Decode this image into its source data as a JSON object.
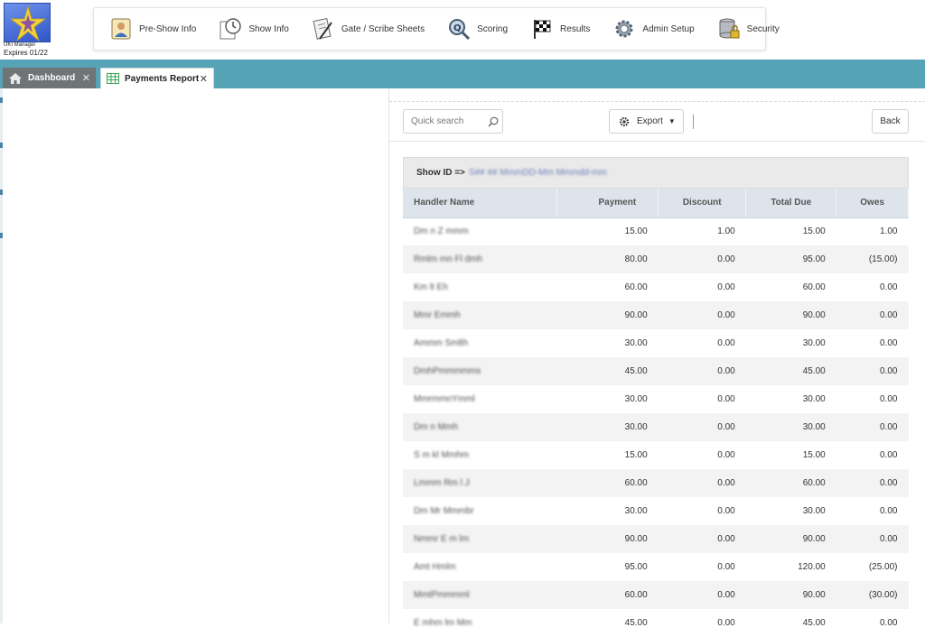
{
  "app": {
    "logo_caption": "UKI Manager",
    "logo_expiry": "Expires 01/22"
  },
  "nav": [
    {
      "label": "Pre-Show Info",
      "icon": "person-card-icon"
    },
    {
      "label": "Show Info",
      "icon": "clock-document-icon"
    },
    {
      "label": "Gate / Scribe Sheets",
      "icon": "clipboard-pen-icon"
    },
    {
      "label": "Scoring",
      "icon": "magnifier-q-icon"
    },
    {
      "label": "Results",
      "icon": "checkered-flag-icon"
    },
    {
      "label": "Admin Setup",
      "icon": "gear-icon"
    },
    {
      "label": "Security",
      "icon": "database-lock-icon"
    }
  ],
  "tabs": {
    "dashboard": {
      "label": "Dashboard",
      "icon": "home-icon",
      "close": "✕"
    },
    "payments": {
      "label": "Payments Report",
      "icon": "spreadsheet-icon",
      "close": "✕"
    }
  },
  "toolbar": {
    "search_placeholder": "Quick search",
    "export_label": "Export",
    "back_label": "Back"
  },
  "report": {
    "showid_label": "Show ID =>",
    "showid_value": "S## ## MmmDD-Mm Mmmdd-mm",
    "columns": [
      "Handler Name",
      "Payment",
      "Discount",
      "Total Due",
      "Owes"
    ],
    "rows": [
      {
        "name": "Dm n Z mmm",
        "payment": "15.00",
        "discount": "1.00",
        "total": "15.00",
        "owes": "1.00"
      },
      {
        "name": "Rmlm mn Fl dmh",
        "payment": "80.00",
        "discount": "0.00",
        "total": "95.00",
        "owes": "(15.00)"
      },
      {
        "name": "Km lt Eh",
        "payment": "60.00",
        "discount": "0.00",
        "total": "60.00",
        "owes": "0.00"
      },
      {
        "name": "Mmr Emmh",
        "payment": "90.00",
        "discount": "0.00",
        "total": "90.00",
        "owes": "0.00"
      },
      {
        "name": "Ammm Smlth",
        "payment": "30.00",
        "discount": "0.00",
        "total": "30.00",
        "owes": "0.00"
      },
      {
        "name": "DmhPmmmmms",
        "payment": "45.00",
        "discount": "0.00",
        "total": "45.00",
        "owes": "0.00"
      },
      {
        "name": "MmrmmnYmml",
        "payment": "30.00",
        "discount": "0.00",
        "total": "30.00",
        "owes": "0.00"
      },
      {
        "name": "Dm n Mmh",
        "payment": "30.00",
        "discount": "0.00",
        "total": "30.00",
        "owes": "0.00"
      },
      {
        "name": "S m kl Mmhm",
        "payment": "15.00",
        "discount": "0.00",
        "total": "15.00",
        "owes": "0.00"
      },
      {
        "name": "Lmmm Rm l J",
        "payment": "60.00",
        "discount": "0.00",
        "total": "60.00",
        "owes": "0.00"
      },
      {
        "name": "Dm Mr Mmmbr",
        "payment": "30.00",
        "discount": "0.00",
        "total": "30.00",
        "owes": "0.00"
      },
      {
        "name": "Nmmr E m lm",
        "payment": "90.00",
        "discount": "0.00",
        "total": "90.00",
        "owes": "0.00"
      },
      {
        "name": "Amt Hmlm",
        "payment": "95.00",
        "discount": "0.00",
        "total": "120.00",
        "owes": "(25.00)"
      },
      {
        "name": "MmtPmmmml",
        "payment": "60.00",
        "discount": "0.00",
        "total": "90.00",
        "owes": "(30.00)"
      },
      {
        "name": "E mhm lm Mm",
        "payment": "45.00",
        "discount": "0.00",
        "total": "45.00",
        "owes": "0.00"
      }
    ]
  },
  "colors": {
    "tabstrip": "#56a3b6",
    "header_row": "#dde4ec",
    "dashboard_tab": "#6f7476"
  }
}
